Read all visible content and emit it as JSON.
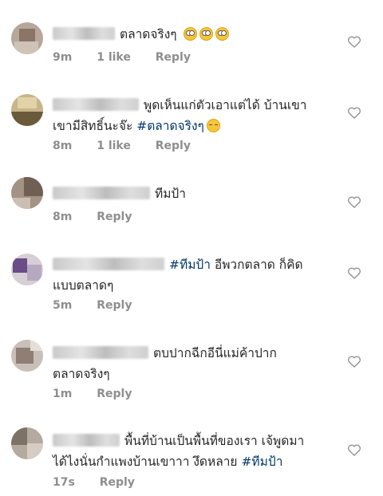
{
  "comments": [
    {
      "text_pre": "ตลาดจริงๆ",
      "tag": "",
      "text_post": "",
      "line2": "",
      "emoji": "rolling-eyes x3",
      "time": "9m",
      "likes": "1 like",
      "reply": "Reply"
    },
    {
      "text_pre": "พูดเห็นแก่ตัวเอาแต่ได้ บ้านเขา",
      "tag": "#ตลาดจริงๆ",
      "line2": "เขามีสิทธิ์นะจ๊ะ",
      "text_post": "",
      "emoji": "pensive",
      "time": "8m",
      "likes": "1 like",
      "reply": "Reply"
    },
    {
      "text_pre": "ทีมป้า",
      "tag": "",
      "text_post": "",
      "line2": "",
      "emoji": "",
      "time": "8m",
      "likes": "",
      "reply": "Reply"
    },
    {
      "text_pre": "",
      "tag": "#ทีมป้า",
      "text_post": "อีพวกตลาด ก็คิด",
      "line2": "แบบตลาดๆ",
      "emoji": "",
      "time": "5m",
      "likes": "",
      "reply": "Reply"
    },
    {
      "text_pre": "ตบปากฉีกอีนี่แม่ค้าปาก",
      "tag": "",
      "text_post": "",
      "line2": "ตลาดจริงๆ",
      "emoji": "",
      "time": "1m",
      "likes": "",
      "reply": "Reply"
    },
    {
      "text_pre": "พื้นที่บ้านเป็นพื้นที่ของเรา เจ้พูดมา",
      "tag": "#ทีมป้า",
      "text_post": "",
      "line2": "ได้ไงนั่นกำแพงบ้านเขาาา งึดหลาย",
      "emoji": "",
      "time": "17s",
      "likes": "",
      "reply": "Reply"
    }
  ],
  "icons": {
    "like": "heart-outline-icon"
  },
  "colors": {
    "hashtag": "#00376b",
    "meta": "#8e8e8e"
  }
}
